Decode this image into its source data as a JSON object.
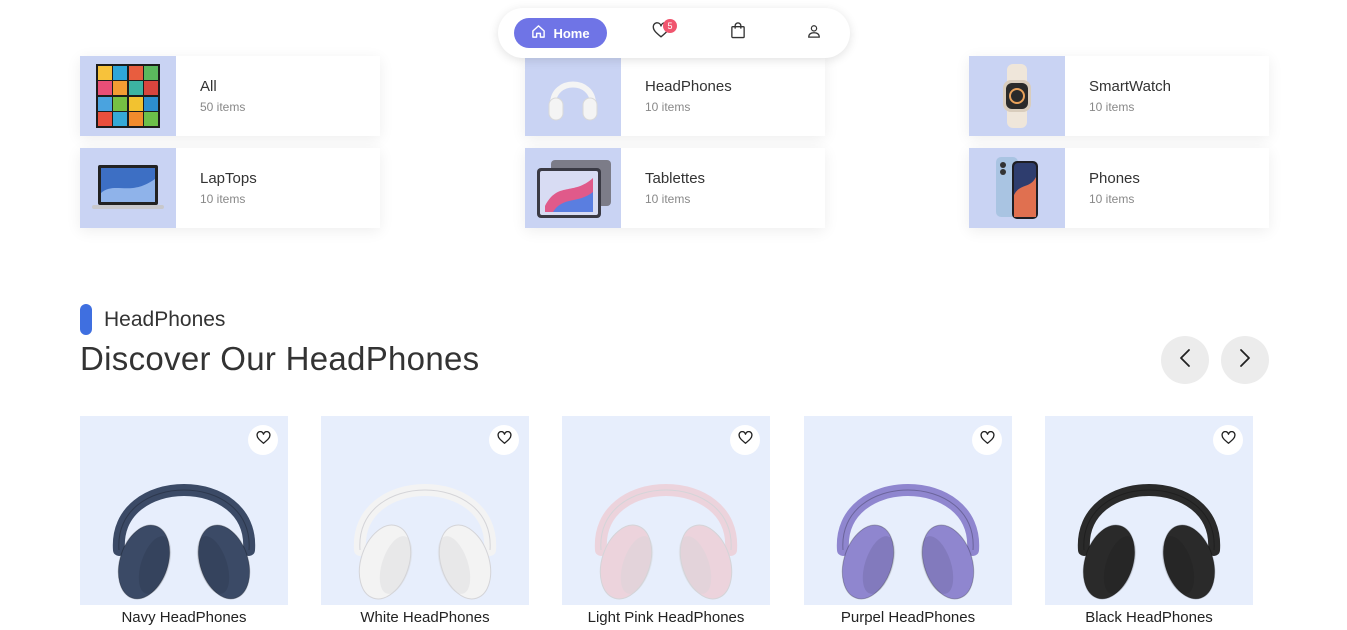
{
  "nav": {
    "home_label": "Home",
    "wishlist_count": "5",
    "items": [
      {
        "icon": "home-icon"
      },
      {
        "icon": "heart-icon"
      },
      {
        "icon": "shopping-bag-icon"
      },
      {
        "icon": "user-icon"
      }
    ]
  },
  "categories": [
    {
      "name": "All",
      "count": "50 items",
      "icon": "all-devices-grid"
    },
    {
      "name": "HeadPhones",
      "count": "10 items",
      "icon": "headphones"
    },
    {
      "name": "SmartWatch",
      "count": "10 items",
      "icon": "smartwatch"
    },
    {
      "name": "LapTops",
      "count": "10 items",
      "icon": "laptop"
    },
    {
      "name": "Tablettes",
      "count": "10 items",
      "icon": "tablet"
    },
    {
      "name": "Phones",
      "count": "10 items",
      "icon": "phone"
    }
  ],
  "section": {
    "label": "HeadPhones",
    "title": "Discover Our HeadPhones",
    "prev_icon": "chevron-left-icon",
    "next_icon": "chevron-right-icon"
  },
  "products": [
    {
      "name": "Navy HeadPhones",
      "color": "#3b4a66"
    },
    {
      "name": "White HeadPhones",
      "color": "#f3f3f3"
    },
    {
      "name": "Light Pink HeadPhones",
      "color": "#ecd3dc"
    },
    {
      "name": "Purpel HeadPhones",
      "color": "#8f86cf"
    },
    {
      "name": "Black HeadPhones",
      "color": "#2a2a2a"
    }
  ],
  "colors": {
    "accent": "#6f74e6",
    "section_bar": "#3f6fe0",
    "badge": "#f0556e",
    "category_bg": "#c9d3f3",
    "product_bg": "#e7eefc"
  }
}
